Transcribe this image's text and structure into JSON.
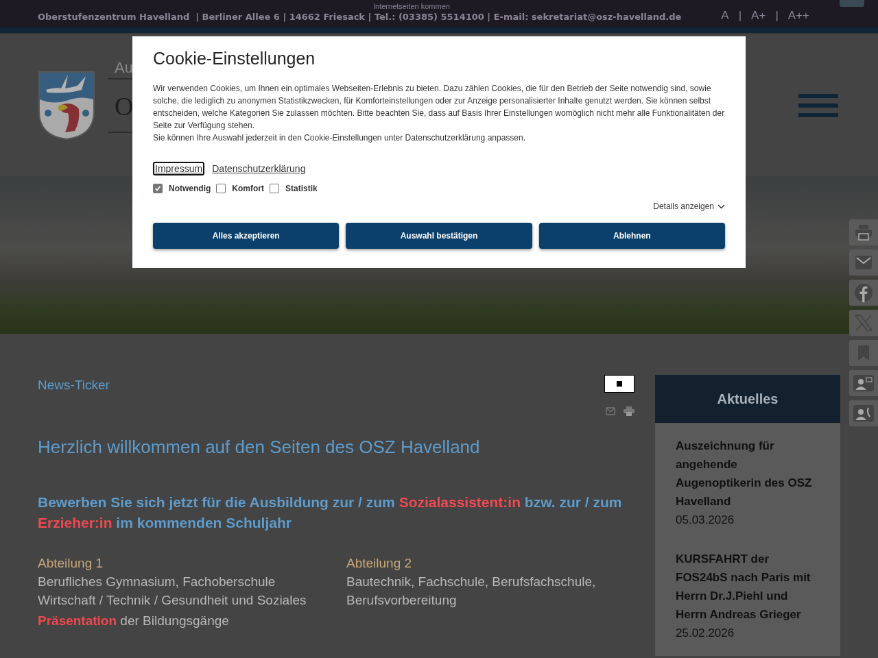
{
  "top_bar": {
    "address": "Oberstufenzentrum Havelland  | Berliner Allee 6 | 14662 Friesack | Tel.: (03385) 5514100 | E-mail: sekretariat@osz-havelland.de",
    "overlay_text": "Internetseiten kommen",
    "font_sizes": [
      "A",
      "A+",
      "A++"
    ],
    "separator": "|"
  },
  "header": {
    "title_fragments": [
      "Au",
      "O"
    ]
  },
  "ticker": {
    "label": "News-Ticker"
  },
  "welcome": {
    "heading": "Herzlich willkommen auf den Seiten des OSZ Havelland",
    "callout": [
      {
        "text": "Bewerben Sie sich jetzt für die Ausbildung zur / zum ",
        "highlight": false
      },
      {
        "text": "Sozialassistent:in",
        "highlight": true
      },
      {
        "text": " bzw. zur / zum ",
        "highlight": false
      },
      {
        "text": "Erzieher:in",
        "highlight": true
      },
      {
        "text": " im kommenden Schuljahr",
        "highlight": false
      }
    ]
  },
  "departments": [
    {
      "title": "Abteilung 1",
      "text": "Berufliches Gymnasium, Fachoberschule Wirtschaft / Technik / Gesundheit und Soziales",
      "link": "Präsentation",
      "link_rest": "der Bildungsgänge"
    },
    {
      "title": "Abteilung 2",
      "text": "Bautechnik, Fachschule, Berufsfachschule, Berufsvorbereitung"
    }
  ],
  "aktuelles": {
    "title": "Aktuelles",
    "items": [
      {
        "title": "Auszeichnung für angehende Augenoptikerin des OSZ Havelland",
        "date": "05.03.2026"
      },
      {
        "title": "KURSFAHRT der FOS24bS nach Paris mit Herrn Dr.J.Piehl und Herrn Andreas Grieger",
        "date": "25.02.2026"
      }
    ]
  },
  "cookie": {
    "title": "Cookie-Einstellungen",
    "paragraphs": [
      "Wir verwenden Cookies, um Ihnen ein optimales Webseiten-Erlebnis zu bieten. Dazu zählen Cookies, die für den Betrieb der Seite notwendig sind, sowie solche, die lediglich zu anonymen Statistikzwecken, für Komforteinstellungen oder zur Anzeige personalisierter Inhalte genutzt werden. Sie können selbst entscheiden, welche Kategorien Sie zulassen möchten. Bitte beachten Sie, dass auf Basis Ihrer Einstellungen womöglich nicht mehr alle Funktionalitäten der Seite zur Verfügung stehen.",
      "Sie können Ihre Auswahl jederzeit in den Cookie-Einstellungen unter Datenschutzerklärung anpassen."
    ],
    "links": [
      {
        "label": "Impressum",
        "focused": true
      },
      {
        "label": "Datenschutzerklärung",
        "focused": false
      }
    ],
    "options": [
      {
        "label": "Notwendig",
        "checked": true,
        "disabled": true
      },
      {
        "label": "Komfort",
        "checked": false,
        "disabled": false
      },
      {
        "label": "Statistik",
        "checked": false,
        "disabled": false
      }
    ],
    "details_label": "Details anzeigen",
    "buttons": [
      "Alles akzeptieren",
      "Auswahl bestätigen",
      "Ablehnen"
    ]
  }
}
